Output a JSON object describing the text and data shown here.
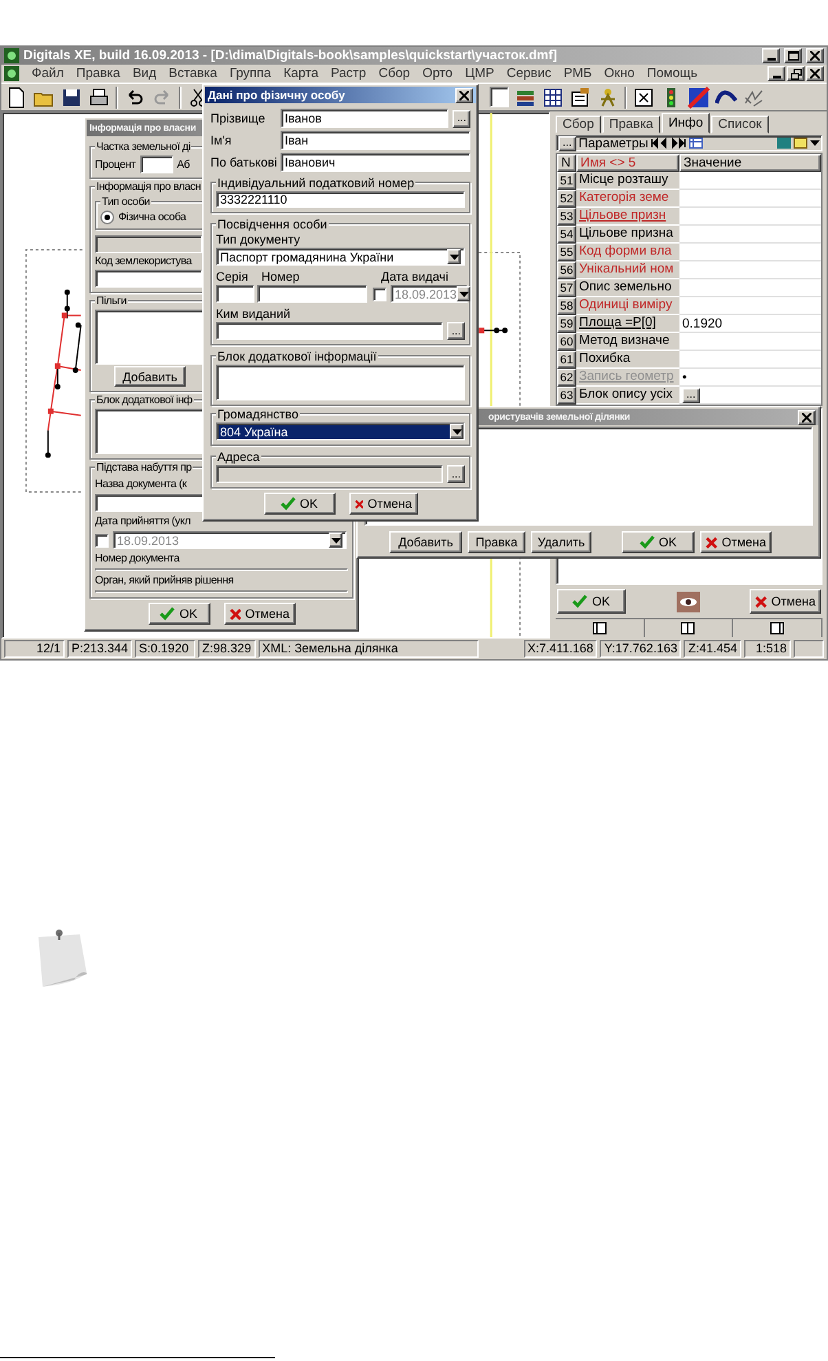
{
  "app": {
    "title": "Digitals XE, build 16.09.2013 - [D:\\dima\\Digitals-book\\samples\\quickstart\\участок.dmf]"
  },
  "menu": [
    "Файл",
    "Правка",
    "Вид",
    "Вставка",
    "Группа",
    "Карта",
    "Растр",
    "Сбор",
    "Орто",
    "ЦМР",
    "Сервис",
    "РМБ",
    "Окно",
    "Помощь"
  ],
  "owner_dialog": {
    "title": "Інформація про власни",
    "share_group": "Частка земельної ді",
    "percent_label": "Процент",
    "abs_label": "Аб",
    "owner_group": "Інформація про власн",
    "person_type_group": "Тип особи",
    "person_type": {
      "label": "Фізична особа",
      "selected": true
    },
    "user_code_label": "Код землекористува",
    "benefits_group": "Пільги",
    "add_button": "Добавить",
    "extra_group": "Блок додаткової інф",
    "basis_group": "Підстава набуття пр",
    "doc_name_label": "Назва документа (к",
    "adopted_date_label": "Дата прийняття (укл",
    "adopted_date": {
      "value": "18.09.2013",
      "checked": false
    },
    "doc_number_label": "Номер документа",
    "authority_label": "Орган, який прийняв рішення",
    "buttons": [
      {
        "label": "OK",
        "kind": "ok"
      },
      {
        "label": "Отмена",
        "kind": "cancel"
      }
    ]
  },
  "person_dialog": {
    "title": "Дані про фізичну особу",
    "name_fields": [
      {
        "label": "Прізвище",
        "value": "Іванов",
        "browse": "..."
      },
      {
        "label": "Ім'я",
        "value": "Іван"
      },
      {
        "label": "По батькові",
        "value": "Іванович"
      }
    ],
    "tax_group": "Індивідуальний податковий номер",
    "tax_number": "3332221110",
    "id_group": "Посвідчення особи",
    "doc_type_label": "Тип документу",
    "doc_type": "Паспорт громадянина України",
    "series_label": "Серія",
    "number_label": "Номер",
    "issue_date_label": "Дата видачі",
    "issue_date": {
      "value": "18.09.2013",
      "checked": false
    },
    "issued_by_label": "Ким виданий",
    "issued_by_browse": "...",
    "extra_group": "Блок додаткової інформації",
    "citizenship_group": "Громадянство",
    "citizenship": {
      "value": "804 Україна",
      "selected": true
    },
    "address_group": "Адреса",
    "address": {
      "disabled": true,
      "browse": "..."
    },
    "buttons": [
      {
        "label": "OK",
        "kind": "ok"
      },
      {
        "label": "Отмена",
        "kind": "cancel"
      }
    ]
  },
  "users_dialog": {
    "title": "ористувачів земельної ділянки",
    "buttons": [
      {
        "label": "Добавить",
        "kind": "plain"
      },
      {
        "label": "Правка",
        "kind": "plain"
      },
      {
        "label": "Удалить",
        "kind": "plain"
      },
      {
        "label": "OK",
        "kind": "ok"
      },
      {
        "label": "Отмена",
        "kind": "cancel"
      }
    ]
  },
  "right_panel": {
    "tabs": [
      {
        "label": "Сбор",
        "selected": false
      },
      {
        "label": "Правка",
        "selected": false
      },
      {
        "label": "Инфо",
        "selected": true
      },
      {
        "label": "Список",
        "selected": false
      }
    ],
    "params_button": "...",
    "params_label": "Параметры",
    "columns": [
      {
        "label": "N",
        "filtered": false
      },
      {
        "label": "Имя <> 5",
        "filtered": true
      },
      {
        "label": "Значение",
        "filtered": false
      }
    ],
    "rows": [
      {
        "n": "51",
        "name": "Місце розташу",
        "kind": "plain"
      },
      {
        "n": "52",
        "name": "Категорія земе",
        "kind": "required"
      },
      {
        "n": "53",
        "name": "Цільове призн",
        "kind": "required-link"
      },
      {
        "n": "54",
        "name": "Цільове призна",
        "kind": "plain"
      },
      {
        "n": "55",
        "name": "Код форми вла",
        "kind": "required"
      },
      {
        "n": "56",
        "name": "Унікальний ном",
        "kind": "required"
      },
      {
        "n": "57",
        "name": "Опис земельно",
        "kind": "plain"
      },
      {
        "n": "58",
        "name": "Одиниці виміру",
        "kind": "required"
      },
      {
        "n": "59",
        "name": "Площа =P[0]",
        "kind": "link",
        "value": "0.1920"
      },
      {
        "n": "60",
        "name": "Метод визначе",
        "kind": "plain"
      },
      {
        "n": "61",
        "name": "Похибка",
        "kind": "plain"
      },
      {
        "n": "62",
        "name": "Запись геометр",
        "kind": "inactive",
        "value": "•"
      },
      {
        "n": "63",
        "name": "Блок опису усіх",
        "kind": "plain",
        "more": "..."
      }
    ],
    "buttons": [
      {
        "label": "OK",
        "kind": "ok"
      },
      {
        "label": "Отмена",
        "kind": "cancel"
      }
    ]
  },
  "status_bar": {
    "left": [
      "12/1",
      "P:213.344",
      "S:0.1920",
      "Z:98.329",
      "XML: Земельна ділянка"
    ],
    "right": [
      "X:7.411.168",
      "Y:17.762.163",
      "Z:41.454",
      "1:518"
    ]
  }
}
